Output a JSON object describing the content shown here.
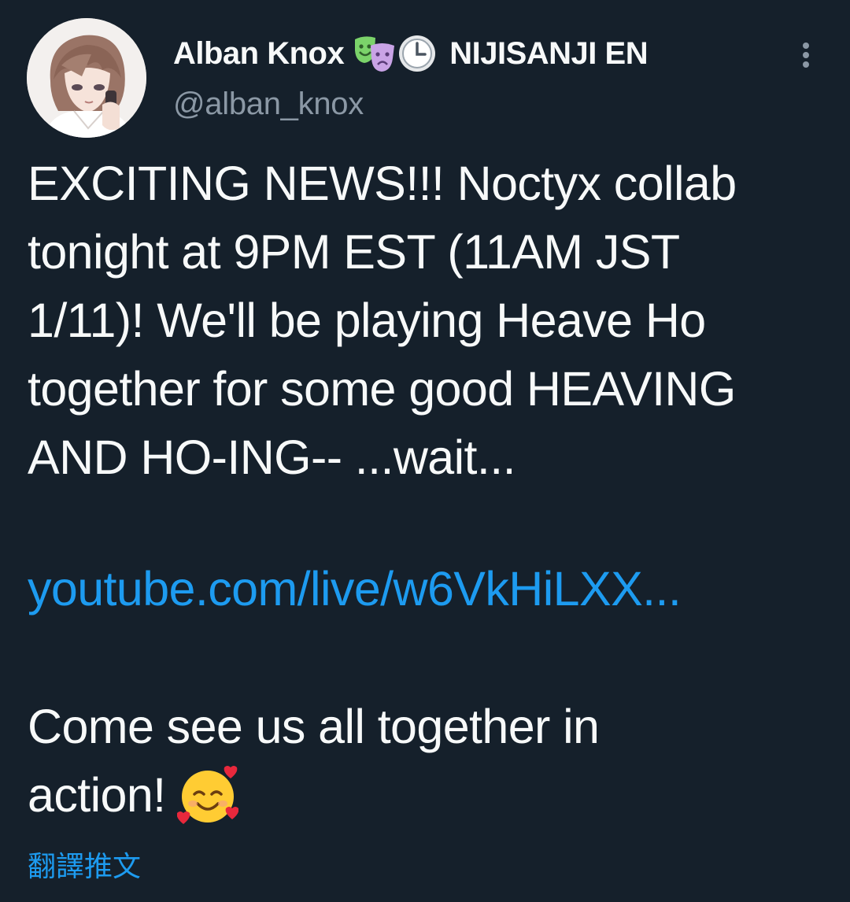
{
  "tweet": {
    "display_name": "Alban Knox",
    "name_emojis": [
      "performing-arts-icon",
      "clock-icon"
    ],
    "affiliation": "NIJISANJI EN",
    "handle": "@alban_knox",
    "body": "EXCITING NEWS!!! Noctyx collab\ntonight at 9PM EST (11AM JST\n1/11)! We'll be playing Heave Ho\ntogether for some good HEAVING\nAND HO-ING-- ...wait...",
    "link": "youtube.com/live/w6VkHiLXX...",
    "closing_line1": "Come see us all together in",
    "closing_line2": "action!",
    "closing_emoji": "smiling-face-with-hearts-icon",
    "translate_label": "翻譯推文"
  },
  "colors": {
    "background": "#15202b",
    "text_primary": "#f7f9f9",
    "text_secondary": "#8b98a5",
    "link": "#1d9bf0"
  }
}
